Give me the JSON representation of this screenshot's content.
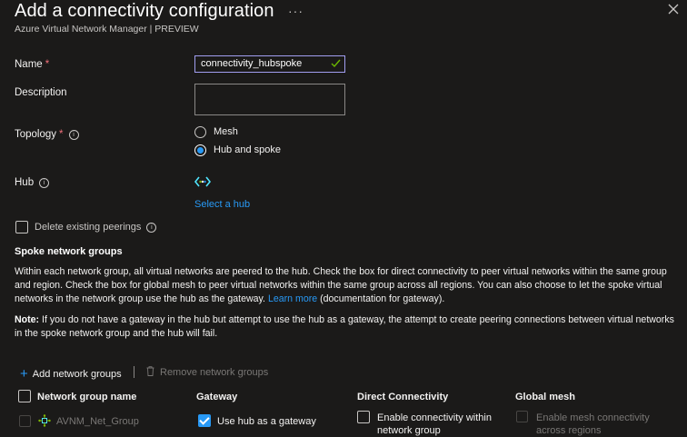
{
  "header": {
    "title": "Add a connectivity configuration",
    "subtitle": "Azure Virtual Network Manager | PREVIEW",
    "more_label": "···"
  },
  "form": {
    "name_label": "Name",
    "name_value": "connectivity_hubspoke",
    "description_label": "Description",
    "description_value": "",
    "topology_label": "Topology",
    "topology_options": [
      "Mesh",
      "Hub and spoke"
    ],
    "topology_selected": "Hub and spoke",
    "hub_label": "Hub",
    "select_hub_link": "Select a hub",
    "delete_peerings_label": "Delete existing peerings",
    "required_marker": "*"
  },
  "spoke": {
    "heading": "Spoke network groups",
    "paragraph_before_link": "Within each network group, all virtual networks are peered to the hub. Check the box for direct connectivity to peer virtual networks within the same group and region. Check the box for global mesh to peer virtual networks within the same group across all regions. You can also choose to let the spoke virtual networks in the network group use the hub as the gateway.",
    "learn_more": "Learn more",
    "paragraph_after_link": "(documentation for gateway).",
    "note_label": "Note:",
    "note_text": "If you do not have a gateway in the hub but attempt to use the hub as a gateway, the attempt to create peering connections between virtual networks in the spoke network group and the hub will fail."
  },
  "toolbar": {
    "add_label": "Add network groups",
    "remove_label": "Remove network groups"
  },
  "table": {
    "columns": [
      "Network group name",
      "Gateway",
      "Direct Connectivity",
      "Global mesh"
    ],
    "rows": [
      {
        "name": "AVNM_Net_Group",
        "gateway_label": "Use hub as a gateway",
        "gateway_checked": true,
        "direct_label": "Enable connectivity within network group",
        "direct_checked": false,
        "mesh_label": "Enable mesh connectivity across regions",
        "mesh_checked": false
      }
    ]
  },
  "colors": {
    "background": "#1b1a19",
    "accent": "#2899f5",
    "required": "#f1707b",
    "input_focus_border": "#a19ef0",
    "valid_check": "#6bb700"
  }
}
